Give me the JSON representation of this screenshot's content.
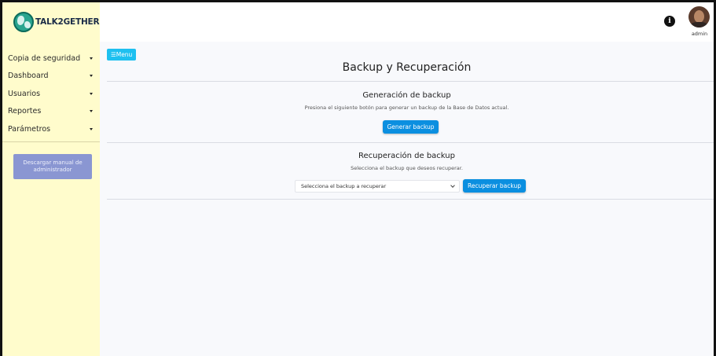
{
  "brand": {
    "name": "TALK2GETHER"
  },
  "sidebar": {
    "items": [
      {
        "label": "Copia de seguridad"
      },
      {
        "label": "Dashboard"
      },
      {
        "label": "Usuarios"
      },
      {
        "label": "Reportes"
      },
      {
        "label": "Parámetros"
      }
    ],
    "manual_button": "Descargar manual de administrador"
  },
  "topbar": {
    "user_name": "admin"
  },
  "toolbar": {
    "menu_label": "☰Menu"
  },
  "page": {
    "title": "Backup y Recuperación"
  },
  "backup_section": {
    "title": "Generación de backup",
    "description": "Presiona el siguiente botón para generar un backup de la Base de Datos actual.",
    "button": "Generar backup"
  },
  "recovery_section": {
    "title": "Recuperación de backup",
    "description": "Selecciona el backup que deseos recuperar.",
    "select_value": "Selecciona el backup a recuperar",
    "button": "Recuperar backup"
  },
  "colors": {
    "sidebar_bg": "#fffccc",
    "primary": "#0b8fe0",
    "menu_button": "#1ec0f0",
    "manual_button": "#8a96d2"
  }
}
